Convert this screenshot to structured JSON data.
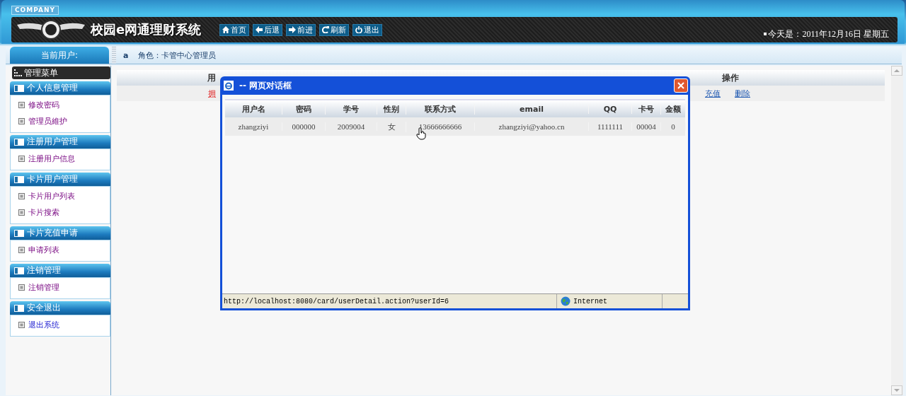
{
  "header": {
    "company": "COMPANY",
    "title": "校园e网通理财系统",
    "date": "今天是：2011年12月16日  星期五",
    "nav": [
      {
        "label": "首页",
        "kind": "home"
      },
      {
        "label": "后退",
        "kind": "back"
      },
      {
        "label": "前进",
        "kind": "forward"
      },
      {
        "label": "刷新",
        "kind": "refresh"
      },
      {
        "label": "退出",
        "kind": "power"
      }
    ]
  },
  "user_bar": {
    "title": "当前用户:",
    "user": "a",
    "role": "角色：卡管中心管理员"
  },
  "sidebar": {
    "title": "管理菜单",
    "groups": [
      {
        "title": "个人信息管理",
        "items": [
          {
            "label": "修改密码",
            "visited": true
          },
          {
            "label": "管理员維护",
            "visited": true
          }
        ]
      },
      {
        "title": "注册用户管理",
        "items": [
          {
            "label": "注册用户信息",
            "visited": true
          }
        ]
      },
      {
        "title": "卡片用户管理",
        "items": [
          {
            "label": "卡片用户列表",
            "visited": true
          },
          {
            "label": "卡片搜索",
            "visited": true
          }
        ]
      },
      {
        "title": "卡片充值申请",
        "items": [
          {
            "label": "申请列表",
            "visited": true
          }
        ]
      },
      {
        "title": "注销管理",
        "items": [
          {
            "label": "注销管理",
            "visited": true
          }
        ]
      },
      {
        "title": "安全退出",
        "items": [
          {
            "label": "退出系统",
            "visited": false
          }
        ]
      }
    ]
  },
  "table": {
    "column_1": "用",
    "column_3": "操作",
    "row": {
      "cell_1": "拥",
      "actions": [
        "充值",
        "删除"
      ]
    }
  },
  "dialog": {
    "title": "-- 网页对话框",
    "columns": [
      "用户名",
      "密码",
      "学号",
      "性别",
      "联系方式",
      "email",
      "QQ",
      "卡号",
      "金额"
    ],
    "rows": [
      [
        "zhangziyi",
        "000000",
        "2009004",
        "女",
        "13666666666",
        "zhangziyi@yahoo.cn",
        "1111111",
        "00004",
        "0"
      ]
    ],
    "status_url": "http://localhost:8080/card/userDetail.action?userId=6",
    "zone": "Internet"
  }
}
